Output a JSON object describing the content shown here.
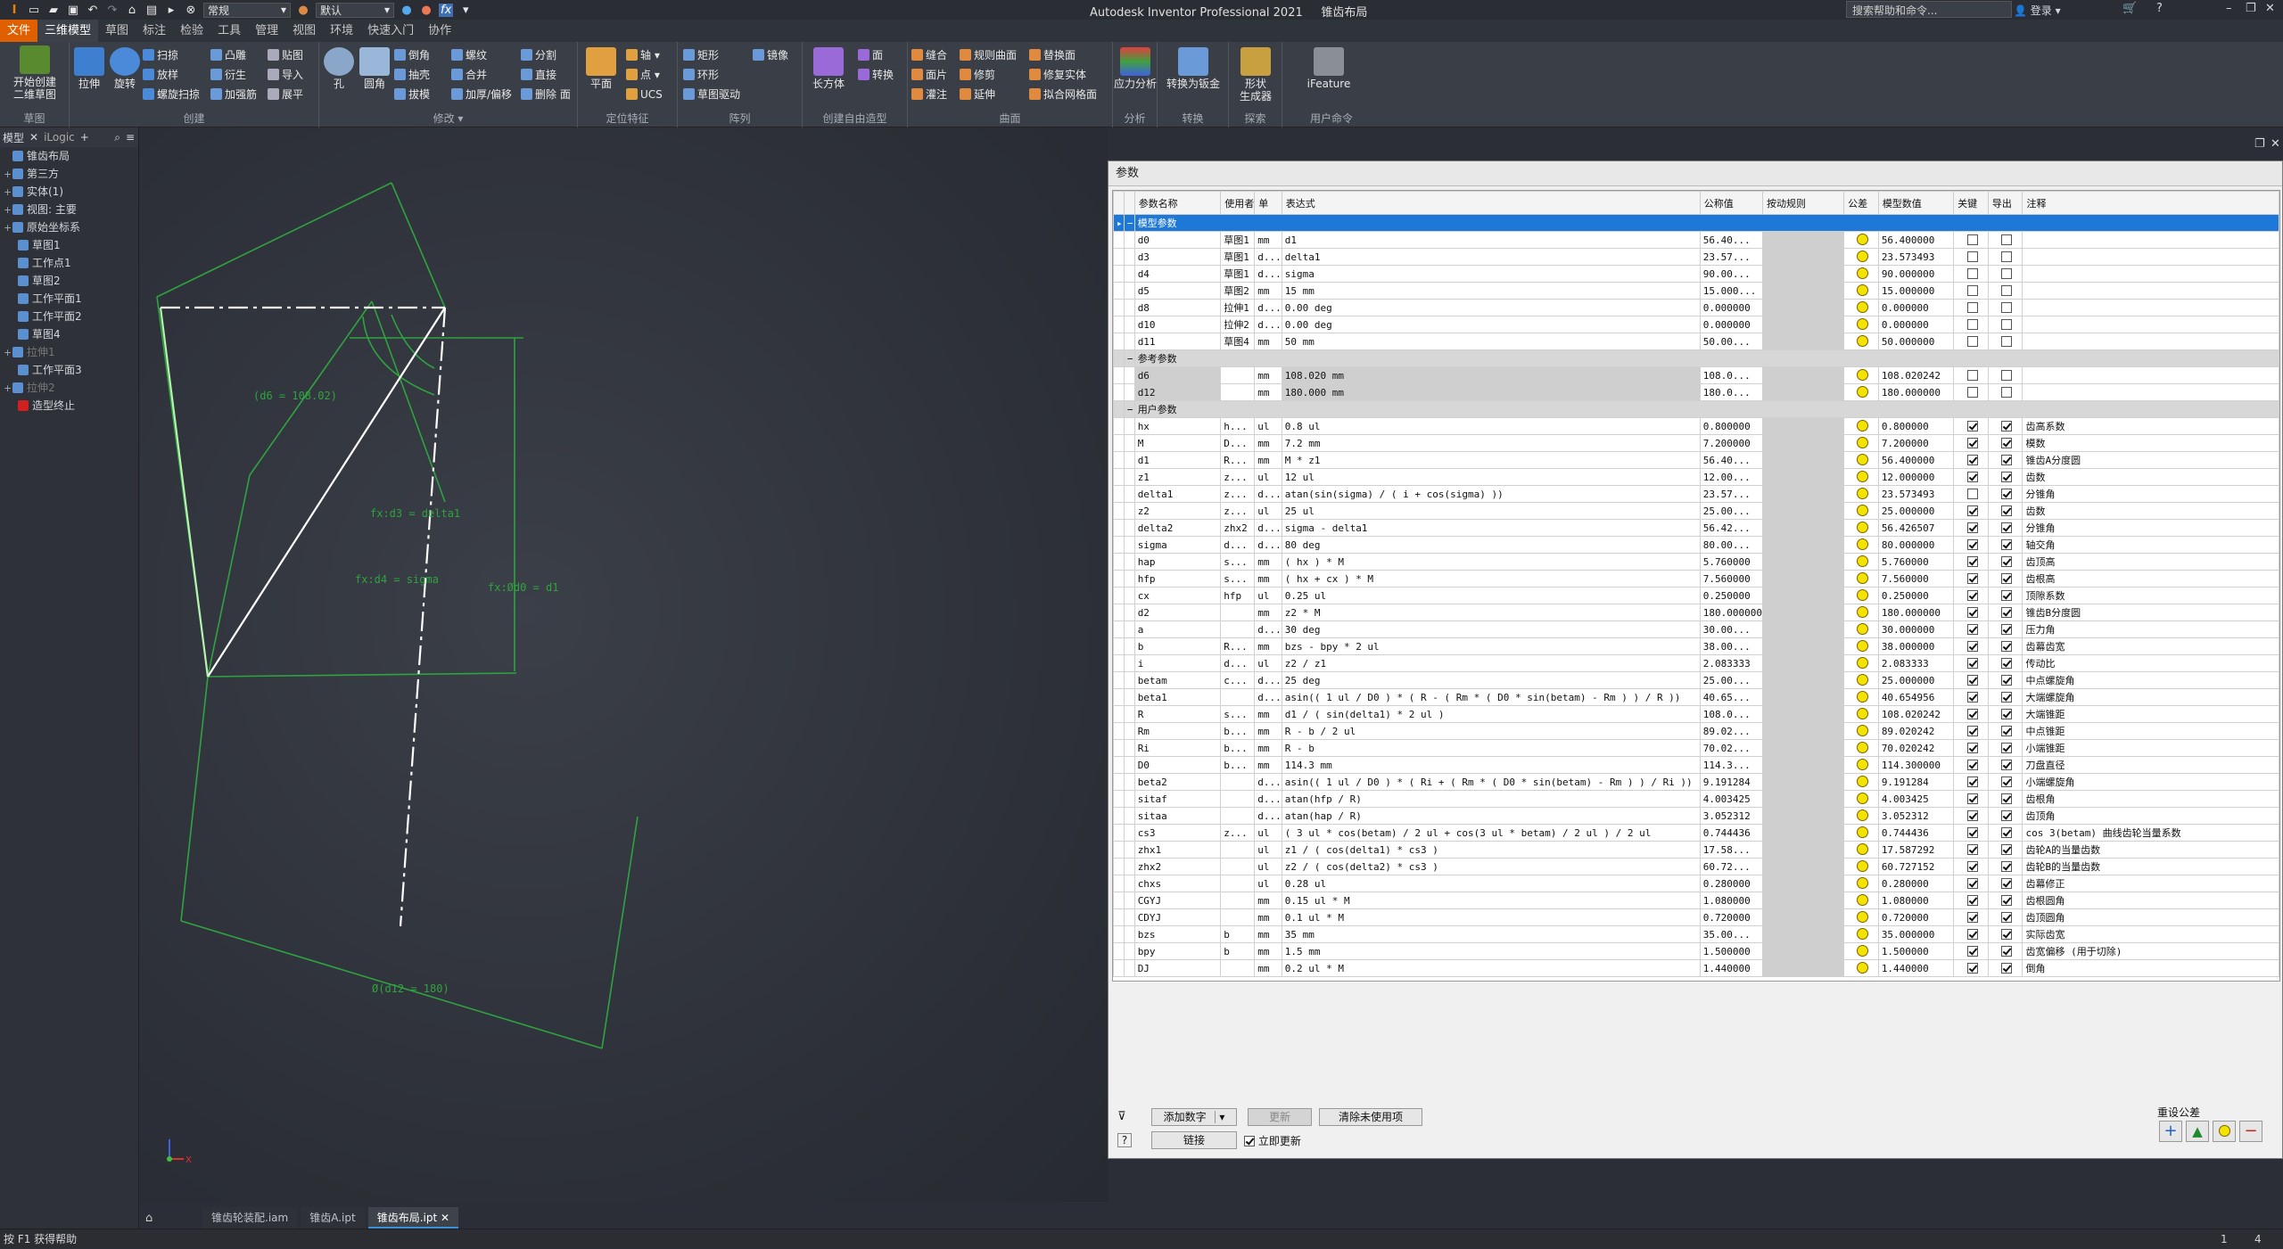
{
  "app": {
    "title": "Autodesk Inventor Professional 2021",
    "document": "锥齿布局",
    "help_search_placeholder": "搜索帮助和命令...",
    "login_label": "登录",
    "appearance_select": "常规",
    "material_select": "默认"
  },
  "menu": [
    "文件",
    "三维模型",
    "草图",
    "标注",
    "检验",
    "工具",
    "管理",
    "视图",
    "环境",
    "快速入门",
    "协作"
  ],
  "ribbon": {
    "sketch": {
      "big": "开始创建\n二维草图",
      "group": "草图"
    },
    "create": {
      "big1": "拉伸",
      "big2": "旋转",
      "small": [
        "扫掠",
        "放样",
        "螺旋扫掠",
        "凸雕",
        "衍生",
        "加强筋",
        "贴图",
        "导入",
        "展平"
      ],
      "group": "创建"
    },
    "modify": {
      "big1": "孔",
      "big2": "圆角",
      "small": [
        "倒角",
        "抽壳",
        "拔模",
        "螺纹",
        "合并",
        "加厚/偏移",
        "分割",
        "直接",
        "删除 面"
      ],
      "group": "修改 ▾"
    },
    "workfeat": {
      "big": "平面",
      "small": [
        "轴 ▾",
        "点 ▾",
        "UCS"
      ],
      "group": "定位特征"
    },
    "pattern": {
      "small": [
        "矩形",
        "环形",
        "草图驱动",
        "镜像"
      ],
      "group": "阵列"
    },
    "freeform": {
      "big": "长方体",
      "small": [
        "面",
        "转换"
      ],
      "group": "创建自由造型"
    },
    "surface": {
      "small": [
        "缝合",
        "面片",
        "灌注",
        "规则曲面",
        "修剪",
        "延伸",
        "替换面",
        "修复实体",
        "拟合网格面"
      ],
      "group": "曲面"
    },
    "analysis": {
      "big": "应力分析",
      "group": "分析"
    },
    "convert": {
      "big": "转换为钣金",
      "group": "转换"
    },
    "explore": {
      "big": "形状\n生成器",
      "group": "探索"
    },
    "user": {
      "big": "iFeature",
      "group": "用户命令"
    }
  },
  "browser": {
    "tab_model": "模型",
    "tab_ilogic": "iLogic",
    "items": [
      {
        "label": "锥齿布局",
        "level": 0,
        "exp": ""
      },
      {
        "label": "第三方",
        "level": 0,
        "exp": "+"
      },
      {
        "label": "实体(1)",
        "level": 0,
        "exp": "+"
      },
      {
        "label": "视图: 主要",
        "level": 0,
        "exp": "+"
      },
      {
        "label": "原始坐标系",
        "level": 0,
        "exp": "+"
      },
      {
        "label": "草图1",
        "level": 1,
        "exp": ""
      },
      {
        "label": "工作点1",
        "level": 1,
        "exp": ""
      },
      {
        "label": "草图2",
        "level": 1,
        "exp": ""
      },
      {
        "label": "工作平面1",
        "level": 1,
        "exp": ""
      },
      {
        "label": "工作平面2",
        "level": 1,
        "exp": ""
      },
      {
        "label": "草图4",
        "level": 1,
        "exp": ""
      },
      {
        "label": "拉伸1",
        "level": 0,
        "exp": "+"
      },
      {
        "label": "工作平面3",
        "level": 1,
        "exp": ""
      },
      {
        "label": "拉伸2",
        "level": 0,
        "exp": "+"
      },
      {
        "label": "造型终止",
        "level": 1,
        "exp": ""
      }
    ]
  },
  "canvas": {
    "dim_d6": "(d6 = 108.02)",
    "dim_d3": "fx:d3 = delta1",
    "dim_d4": "fx:d4 = sigma",
    "dim_d0": "fx:Ød0 = d1",
    "dim_d12": "Ø(d12 = 180)",
    "triad_x": "X"
  },
  "doc_tabs": [
    "锥齿轮装配.iam",
    "锥齿A.ipt",
    "锥齿布局.ipt"
  ],
  "status": {
    "left": "按 F1 获得帮助",
    "r1": "1",
    "r2": "4"
  },
  "params": {
    "title": "参数",
    "headers": [
      "参数名称",
      "使用者",
      "单",
      "表达式",
      "公称值",
      "按动规则",
      "公差",
      "模型数值",
      "关键",
      "导出",
      "注释"
    ],
    "rows": [
      {
        "g": "模型参数",
        "sel": true
      },
      {
        "n": "d0",
        "u": "草图1",
        "un": "mm",
        "e": "d1",
        "nom": "56.40...",
        "mv": "56.400000",
        "k": false,
        "x": false,
        "c": ""
      },
      {
        "n": "d3",
        "u": "草图1",
        "un": "d...",
        "e": "delta1",
        "nom": "23.57...",
        "mv": "23.573493",
        "k": false,
        "x": false,
        "c": ""
      },
      {
        "n": "d4",
        "u": "草图1",
        "un": "d...",
        "e": "sigma",
        "nom": "90.00...",
        "mv": "90.000000",
        "k": false,
        "x": false,
        "c": ""
      },
      {
        "n": "d5",
        "u": "草图2",
        "un": "mm",
        "e": "15 mm",
        "nom": "15.000...",
        "mv": "15.000000",
        "k": false,
        "x": false,
        "c": ""
      },
      {
        "n": "d8",
        "u": "拉伸1",
        "un": "d...",
        "e": "0.00 deg",
        "nom": "0.000000",
        "mv": "0.000000",
        "k": false,
        "x": false,
        "c": ""
      },
      {
        "n": "d10",
        "u": "拉伸2",
        "un": "d...",
        "e": "0.00 deg",
        "nom": "0.000000",
        "mv": "0.000000",
        "k": false,
        "x": false,
        "c": ""
      },
      {
        "n": "d11",
        "u": "草图4",
        "un": "mm",
        "e": "50 mm",
        "nom": "50.00...",
        "mv": "50.000000",
        "k": false,
        "x": false,
        "c": ""
      },
      {
        "g": "参考参数"
      },
      {
        "n": "d6",
        "u": "",
        "un": "mm",
        "e": "108.020 mm",
        "nom": "108.0...",
        "mv": "108.020242",
        "k": false,
        "x": false,
        "c": "",
        "gray": true
      },
      {
        "n": "d12",
        "u": "",
        "un": "mm",
        "e": "180.000 mm",
        "nom": "180.0...",
        "mv": "180.000000",
        "k": false,
        "x": false,
        "c": "",
        "gray": true
      },
      {
        "g": "用户参数"
      },
      {
        "n": "hx",
        "u": "h...",
        "un": "ul",
        "e": "0.8 ul",
        "nom": "0.800000",
        "mv": "0.800000",
        "k": true,
        "x": true,
        "c": "齿高系数"
      },
      {
        "n": "M",
        "u": "D...",
        "un": "mm",
        "e": "7.2 mm",
        "nom": "7.200000",
        "mv": "7.200000",
        "k": true,
        "x": true,
        "c": "模数"
      },
      {
        "n": "d1",
        "u": "R...",
        "un": "mm",
        "e": "M * z1",
        "nom": "56.40...",
        "mv": "56.400000",
        "k": true,
        "x": true,
        "c": "锥齿A分度圆"
      },
      {
        "n": "z1",
        "u": "z...",
        "un": "ul",
        "e": "12 ul",
        "nom": "12.00...",
        "mv": "12.000000",
        "k": true,
        "x": true,
        "c": "齿数"
      },
      {
        "n": "delta1",
        "u": "z...",
        "un": "d...",
        "e": "atan(sin(sigma) / ( i + cos(sigma) ))",
        "nom": "23.57...",
        "mv": "23.573493",
        "k": false,
        "x": true,
        "c": "分锥角"
      },
      {
        "n": "z2",
        "u": "z...",
        "un": "ul",
        "e": "25 ul",
        "nom": "25.00...",
        "mv": "25.000000",
        "k": true,
        "x": true,
        "c": "齿数"
      },
      {
        "n": "delta2",
        "u": "zhx2",
        "un": "d...",
        "e": "sigma - delta1",
        "nom": "56.42...",
        "mv": "56.426507",
        "k": true,
        "x": true,
        "c": "分锥角"
      },
      {
        "n": "sigma",
        "u": "d...",
        "un": "d...",
        "e": "80 deg",
        "nom": "80.00...",
        "mv": "80.000000",
        "k": true,
        "x": true,
        "c": "轴交角"
      },
      {
        "n": "hap",
        "u": "s...",
        "un": "mm",
        "e": "( hx ) * M",
        "nom": "5.760000",
        "mv": "5.760000",
        "k": true,
        "x": true,
        "c": "齿顶高"
      },
      {
        "n": "hfp",
        "u": "s...",
        "un": "mm",
        "e": "( hx + cx ) * M",
        "nom": "7.560000",
        "mv": "7.560000",
        "k": true,
        "x": true,
        "c": "齿根高"
      },
      {
        "n": "cx",
        "u": "hfp",
        "un": "ul",
        "e": "0.25 ul",
        "nom": "0.250000",
        "mv": "0.250000",
        "k": true,
        "x": true,
        "c": "顶隙系数"
      },
      {
        "n": "d2",
        "u": "",
        "un": "mm",
        "e": "z2 * M",
        "nom": "180.000000",
        "mv": "180.000000",
        "k": true,
        "x": true,
        "c": "锥齿B分度圆"
      },
      {
        "n": "a",
        "u": "",
        "un": "d...",
        "e": "30 deg",
        "nom": "30.00...",
        "mv": "30.000000",
        "k": true,
        "x": true,
        "c": "压力角"
      },
      {
        "n": "b",
        "u": "R...",
        "un": "mm",
        "e": "bzs - bpy * 2 ul",
        "nom": "38.00...",
        "mv": "38.000000",
        "k": true,
        "x": true,
        "c": "齿幕齿宽"
      },
      {
        "n": "i",
        "u": "d...",
        "un": "ul",
        "e": "z2 / z1",
        "nom": "2.083333",
        "mv": "2.083333",
        "k": true,
        "x": true,
        "c": "传动比"
      },
      {
        "n": "betam",
        "u": "c...",
        "un": "d...",
        "e": "25 deg",
        "nom": "25.00...",
        "mv": "25.000000",
        "k": true,
        "x": true,
        "c": "中点螺旋角"
      },
      {
        "n": "beta1",
        "u": "",
        "un": "d...",
        "e": "asin(( 1 ul / D0 ) * ( R - ( Rm * ( D0 * sin(betam) - Rm ) ) / R ))",
        "nom": "40.65...",
        "mv": "40.654956",
        "k": true,
        "x": true,
        "c": "大端螺旋角"
      },
      {
        "n": "R",
        "u": "s...",
        "un": "mm",
        "e": "d1 / ( sin(delta1) * 2 ul )",
        "nom": "108.0...",
        "mv": "108.020242",
        "k": true,
        "x": true,
        "c": "大端锥距"
      },
      {
        "n": "Rm",
        "u": "b...",
        "un": "mm",
        "e": "R - b / 2 ul",
        "nom": "89.02...",
        "mv": "89.020242",
        "k": true,
        "x": true,
        "c": "中点锥距"
      },
      {
        "n": "Ri",
        "u": "b...",
        "un": "mm",
        "e": "R - b",
        "nom": "70.02...",
        "mv": "70.020242",
        "k": true,
        "x": true,
        "c": "小端锥距"
      },
      {
        "n": "D0",
        "u": "b...",
        "un": "mm",
        "e": "114.3 mm",
        "nom": "114.3...",
        "mv": "114.300000",
        "k": true,
        "x": true,
        "c": "刀盘直径"
      },
      {
        "n": "beta2",
        "u": "",
        "un": "d...",
        "e": "asin(( 1 ul / D0 ) * ( Ri + ( Rm * ( D0 * sin(betam) - Rm ) ) / Ri ))",
        "nom": "9.191284",
        "mv": "9.191284",
        "k": true,
        "x": true,
        "c": "小端螺旋角"
      },
      {
        "n": "sitaf",
        "u": "",
        "un": "d...",
        "e": "atan(hfp / R)",
        "nom": "4.003425",
        "mv": "4.003425",
        "k": true,
        "x": true,
        "c": "齿根角"
      },
      {
        "n": "sitaa",
        "u": "",
        "un": "d...",
        "e": "atan(hap / R)",
        "nom": "3.052312",
        "mv": "3.052312",
        "k": true,
        "x": true,
        "c": "齿顶角"
      },
      {
        "n": "cs3",
        "u": "z...",
        "un": "ul",
        "e": "( 3 ul * cos(betam) / 2 ul + cos(3 ul * betam) / 2 ul ) / 2 ul",
        "nom": "0.744436",
        "mv": "0.744436",
        "k": true,
        "x": true,
        "c": "cos 3(betam)  曲线齿轮当量系数"
      },
      {
        "n": "zhx1",
        "u": "",
        "un": "ul",
        "e": "z1 / ( cos(delta1) * cs3 )",
        "nom": "17.58...",
        "mv": "17.587292",
        "k": true,
        "x": true,
        "c": "齿轮A的当量齿数"
      },
      {
        "n": "zhx2",
        "u": "",
        "un": "ul",
        "e": "z2 / ( cos(delta2) * cs3 )",
        "nom": "60.72...",
        "mv": "60.727152",
        "k": true,
        "x": true,
        "c": "齿轮B的当量齿数"
      },
      {
        "n": "chxs",
        "u": "",
        "un": "ul",
        "e": "0.28 ul",
        "nom": "0.280000",
        "mv": "0.280000",
        "k": true,
        "x": true,
        "c": "齿幕修正"
      },
      {
        "n": "CGYJ",
        "u": "",
        "un": "mm",
        "e": "0.15 ul * M",
        "nom": "1.080000",
        "mv": "1.080000",
        "k": true,
        "x": true,
        "c": "齿根圆角"
      },
      {
        "n": "CDYJ",
        "u": "",
        "un": "mm",
        "e": "0.1 ul * M",
        "nom": "0.720000",
        "mv": "0.720000",
        "k": true,
        "x": true,
        "c": "齿顶圆角"
      },
      {
        "n": "bzs",
        "u": "b",
        "un": "mm",
        "e": "35 mm",
        "nom": "35.00...",
        "mv": "35.000000",
        "k": true,
        "x": true,
        "c": "实际齿宽"
      },
      {
        "n": "bpy",
        "u": "b",
        "un": "mm",
        "e": "1.5 mm",
        "nom": "1.500000",
        "mv": "1.500000",
        "k": true,
        "x": true,
        "c": "齿宽偏移 (用于切除)"
      },
      {
        "n": "DJ",
        "u": "",
        "un": "mm",
        "e": "0.2 ul * M",
        "nom": "1.440000",
        "mv": "1.440000",
        "k": true,
        "x": true,
        "c": "倒角"
      }
    ],
    "add_number": "添加数字",
    "update": "更新",
    "purge": "清除未使用项",
    "link": "链接",
    "immediate_update": "立即更新",
    "reset_tolerance": "重设公差"
  }
}
